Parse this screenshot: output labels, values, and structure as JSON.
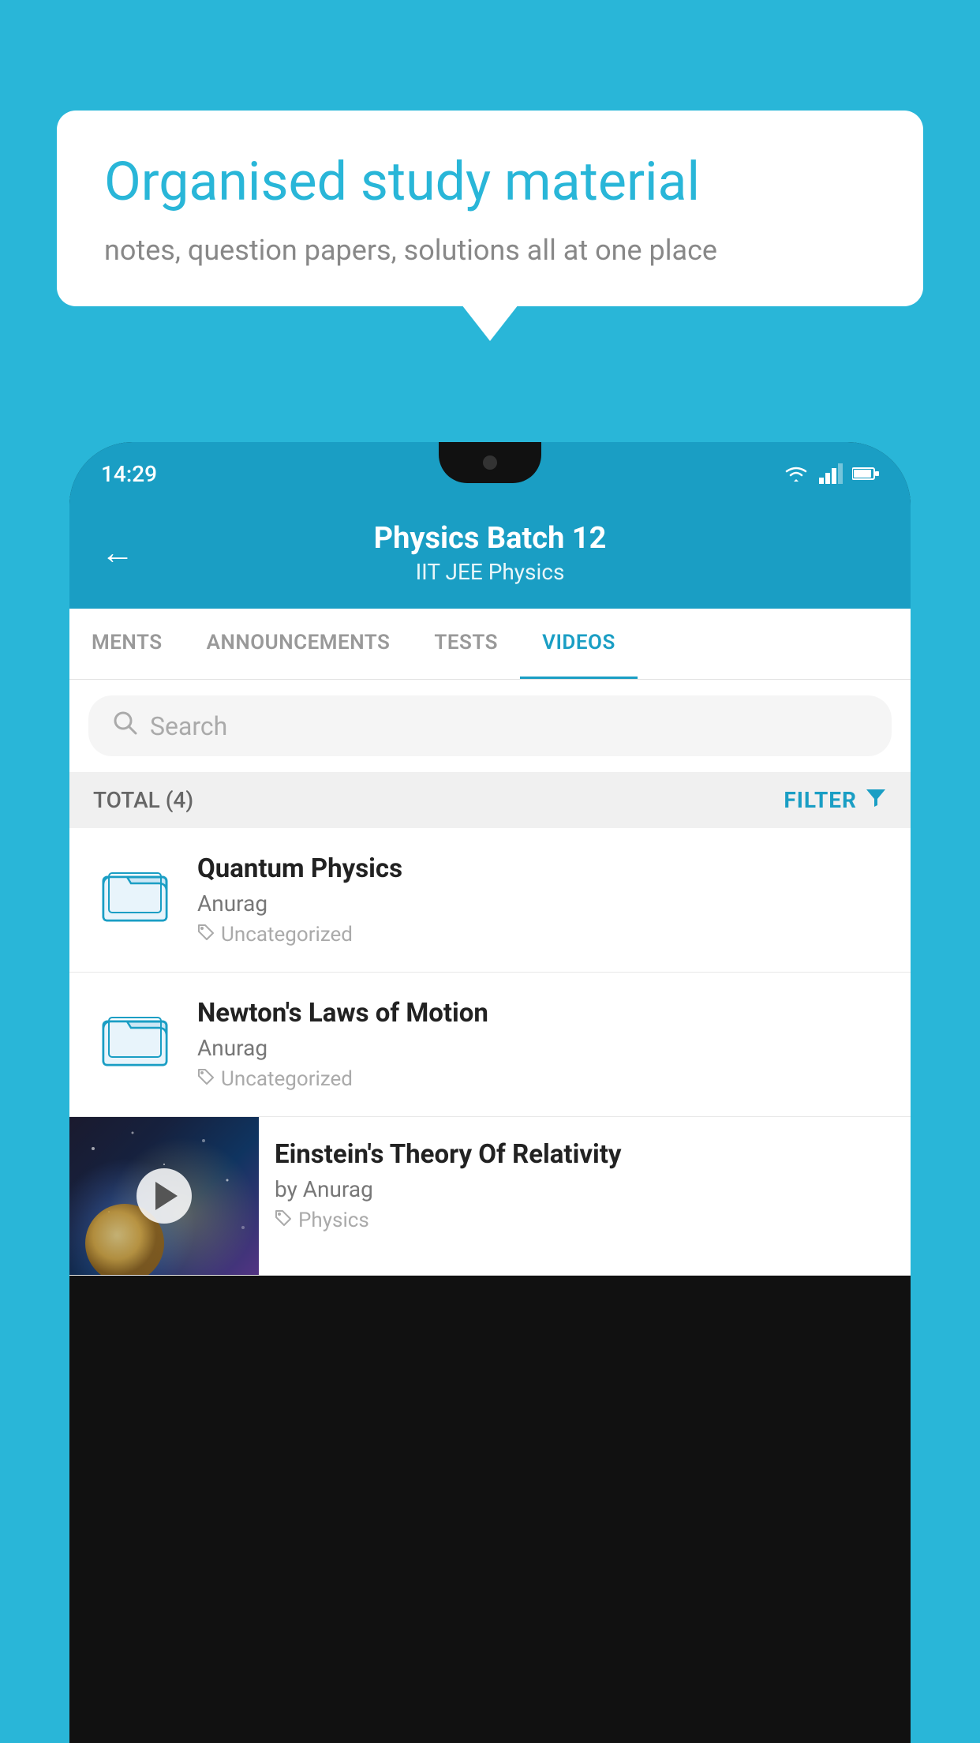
{
  "background_color": "#29b6d8",
  "bubble": {
    "title": "Organised study material",
    "subtitle": "notes, question papers, solutions all at one place"
  },
  "status_bar": {
    "time": "14:29"
  },
  "app_header": {
    "back_label": "←",
    "title": "Physics Batch 12",
    "subtitle": "IIT JEE   Physics"
  },
  "tabs": [
    {
      "label": "MENTS",
      "active": false
    },
    {
      "label": "ANNOUNCEMENTS",
      "active": false
    },
    {
      "label": "TESTS",
      "active": false
    },
    {
      "label": "VIDEOS",
      "active": true
    }
  ],
  "search": {
    "placeholder": "Search"
  },
  "filter_row": {
    "total": "TOTAL (4)",
    "filter_label": "FILTER"
  },
  "videos": [
    {
      "title": "Quantum Physics",
      "author": "Anurag",
      "tag": "Uncategorized",
      "has_thumbnail": false
    },
    {
      "title": "Newton's Laws of Motion",
      "author": "Anurag",
      "tag": "Uncategorized",
      "has_thumbnail": false
    },
    {
      "title": "Einstein's Theory Of Relativity",
      "author": "by Anurag",
      "tag": "Physics",
      "has_thumbnail": true
    }
  ]
}
